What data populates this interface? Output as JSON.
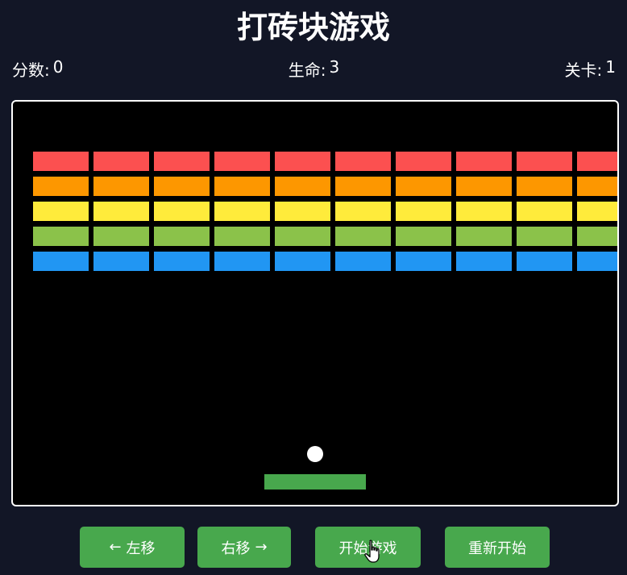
{
  "title": "打砖块游戏",
  "stats": {
    "score_label": "分数:",
    "score": "0",
    "lives_label": "生命:",
    "lives": "3",
    "level_label": "关卡:",
    "level": "1"
  },
  "game": {
    "brick_colors": [
      "#fc5050",
      "#fd9700",
      "#ffeb3b",
      "#8bc24a",
      "#2196f3"
    ],
    "brick_rows": 5,
    "brick_columns_visible": 10,
    "ball_color": "#ffffff",
    "paddle_color": "#48a84d"
  },
  "controls": {
    "left_arrow": "←",
    "left_label": "左移",
    "right_label": "右移",
    "right_arrow": "→",
    "start_label": "开始游戏",
    "restart_label": "重新开始"
  },
  "colors": {
    "background": "#121626",
    "canvas": "#000000",
    "button": "#48a84d"
  }
}
